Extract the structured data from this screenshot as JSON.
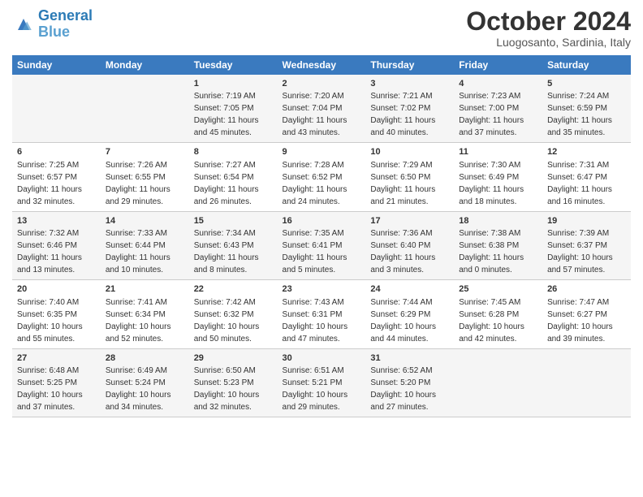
{
  "header": {
    "logo_line1": "General",
    "logo_line2": "Blue",
    "month_title": "October 2024",
    "location": "Luogosanto, Sardinia, Italy"
  },
  "days_of_week": [
    "Sunday",
    "Monday",
    "Tuesday",
    "Wednesday",
    "Thursday",
    "Friday",
    "Saturday"
  ],
  "weeks": [
    [
      {
        "num": "",
        "sunrise": "",
        "sunset": "",
        "daylight": ""
      },
      {
        "num": "",
        "sunrise": "",
        "sunset": "",
        "daylight": ""
      },
      {
        "num": "1",
        "sunrise": "Sunrise: 7:19 AM",
        "sunset": "Sunset: 7:05 PM",
        "daylight": "Daylight: 11 hours and 45 minutes."
      },
      {
        "num": "2",
        "sunrise": "Sunrise: 7:20 AM",
        "sunset": "Sunset: 7:04 PM",
        "daylight": "Daylight: 11 hours and 43 minutes."
      },
      {
        "num": "3",
        "sunrise": "Sunrise: 7:21 AM",
        "sunset": "Sunset: 7:02 PM",
        "daylight": "Daylight: 11 hours and 40 minutes."
      },
      {
        "num": "4",
        "sunrise": "Sunrise: 7:23 AM",
        "sunset": "Sunset: 7:00 PM",
        "daylight": "Daylight: 11 hours and 37 minutes."
      },
      {
        "num": "5",
        "sunrise": "Sunrise: 7:24 AM",
        "sunset": "Sunset: 6:59 PM",
        "daylight": "Daylight: 11 hours and 35 minutes."
      }
    ],
    [
      {
        "num": "6",
        "sunrise": "Sunrise: 7:25 AM",
        "sunset": "Sunset: 6:57 PM",
        "daylight": "Daylight: 11 hours and 32 minutes."
      },
      {
        "num": "7",
        "sunrise": "Sunrise: 7:26 AM",
        "sunset": "Sunset: 6:55 PM",
        "daylight": "Daylight: 11 hours and 29 minutes."
      },
      {
        "num": "8",
        "sunrise": "Sunrise: 7:27 AM",
        "sunset": "Sunset: 6:54 PM",
        "daylight": "Daylight: 11 hours and 26 minutes."
      },
      {
        "num": "9",
        "sunrise": "Sunrise: 7:28 AM",
        "sunset": "Sunset: 6:52 PM",
        "daylight": "Daylight: 11 hours and 24 minutes."
      },
      {
        "num": "10",
        "sunrise": "Sunrise: 7:29 AM",
        "sunset": "Sunset: 6:50 PM",
        "daylight": "Daylight: 11 hours and 21 minutes."
      },
      {
        "num": "11",
        "sunrise": "Sunrise: 7:30 AM",
        "sunset": "Sunset: 6:49 PM",
        "daylight": "Daylight: 11 hours and 18 minutes."
      },
      {
        "num": "12",
        "sunrise": "Sunrise: 7:31 AM",
        "sunset": "Sunset: 6:47 PM",
        "daylight": "Daylight: 11 hours and 16 minutes."
      }
    ],
    [
      {
        "num": "13",
        "sunrise": "Sunrise: 7:32 AM",
        "sunset": "Sunset: 6:46 PM",
        "daylight": "Daylight: 11 hours and 13 minutes."
      },
      {
        "num": "14",
        "sunrise": "Sunrise: 7:33 AM",
        "sunset": "Sunset: 6:44 PM",
        "daylight": "Daylight: 11 hours and 10 minutes."
      },
      {
        "num": "15",
        "sunrise": "Sunrise: 7:34 AM",
        "sunset": "Sunset: 6:43 PM",
        "daylight": "Daylight: 11 hours and 8 minutes."
      },
      {
        "num": "16",
        "sunrise": "Sunrise: 7:35 AM",
        "sunset": "Sunset: 6:41 PM",
        "daylight": "Daylight: 11 hours and 5 minutes."
      },
      {
        "num": "17",
        "sunrise": "Sunrise: 7:36 AM",
        "sunset": "Sunset: 6:40 PM",
        "daylight": "Daylight: 11 hours and 3 minutes."
      },
      {
        "num": "18",
        "sunrise": "Sunrise: 7:38 AM",
        "sunset": "Sunset: 6:38 PM",
        "daylight": "Daylight: 11 hours and 0 minutes."
      },
      {
        "num": "19",
        "sunrise": "Sunrise: 7:39 AM",
        "sunset": "Sunset: 6:37 PM",
        "daylight": "Daylight: 10 hours and 57 minutes."
      }
    ],
    [
      {
        "num": "20",
        "sunrise": "Sunrise: 7:40 AM",
        "sunset": "Sunset: 6:35 PM",
        "daylight": "Daylight: 10 hours and 55 minutes."
      },
      {
        "num": "21",
        "sunrise": "Sunrise: 7:41 AM",
        "sunset": "Sunset: 6:34 PM",
        "daylight": "Daylight: 10 hours and 52 minutes."
      },
      {
        "num": "22",
        "sunrise": "Sunrise: 7:42 AM",
        "sunset": "Sunset: 6:32 PM",
        "daylight": "Daylight: 10 hours and 50 minutes."
      },
      {
        "num": "23",
        "sunrise": "Sunrise: 7:43 AM",
        "sunset": "Sunset: 6:31 PM",
        "daylight": "Daylight: 10 hours and 47 minutes."
      },
      {
        "num": "24",
        "sunrise": "Sunrise: 7:44 AM",
        "sunset": "Sunset: 6:29 PM",
        "daylight": "Daylight: 10 hours and 44 minutes."
      },
      {
        "num": "25",
        "sunrise": "Sunrise: 7:45 AM",
        "sunset": "Sunset: 6:28 PM",
        "daylight": "Daylight: 10 hours and 42 minutes."
      },
      {
        "num": "26",
        "sunrise": "Sunrise: 7:47 AM",
        "sunset": "Sunset: 6:27 PM",
        "daylight": "Daylight: 10 hours and 39 minutes."
      }
    ],
    [
      {
        "num": "27",
        "sunrise": "Sunrise: 6:48 AM",
        "sunset": "Sunset: 5:25 PM",
        "daylight": "Daylight: 10 hours and 37 minutes."
      },
      {
        "num": "28",
        "sunrise": "Sunrise: 6:49 AM",
        "sunset": "Sunset: 5:24 PM",
        "daylight": "Daylight: 10 hours and 34 minutes."
      },
      {
        "num": "29",
        "sunrise": "Sunrise: 6:50 AM",
        "sunset": "Sunset: 5:23 PM",
        "daylight": "Daylight: 10 hours and 32 minutes."
      },
      {
        "num": "30",
        "sunrise": "Sunrise: 6:51 AM",
        "sunset": "Sunset: 5:21 PM",
        "daylight": "Daylight: 10 hours and 29 minutes."
      },
      {
        "num": "31",
        "sunrise": "Sunrise: 6:52 AM",
        "sunset": "Sunset: 5:20 PM",
        "daylight": "Daylight: 10 hours and 27 minutes."
      },
      {
        "num": "",
        "sunrise": "",
        "sunset": "",
        "daylight": ""
      },
      {
        "num": "",
        "sunrise": "",
        "sunset": "",
        "daylight": ""
      }
    ]
  ]
}
